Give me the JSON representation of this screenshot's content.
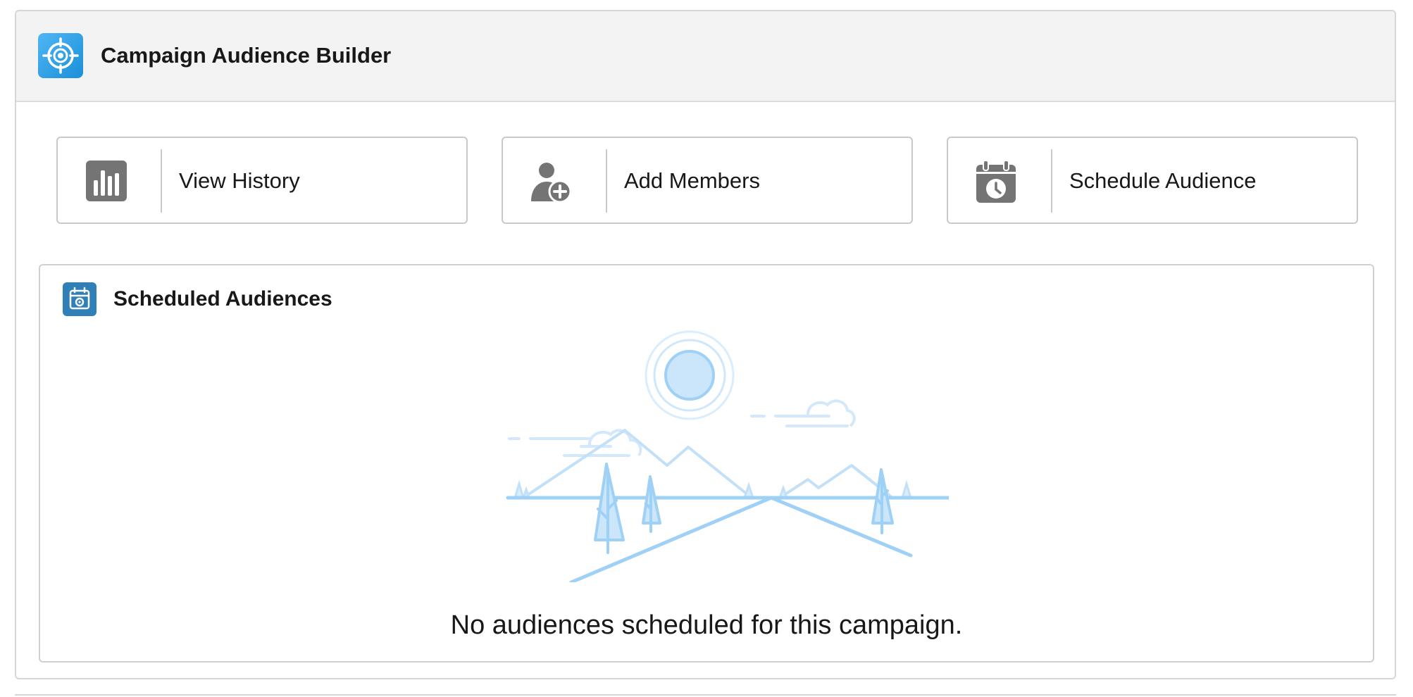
{
  "app": {
    "title": "Campaign Audience Builder",
    "icon": "target-icon",
    "accent_color": "#1b8fd8"
  },
  "actions": [
    {
      "label": "View History",
      "icon": "bar-chart-icon"
    },
    {
      "label": "Add Members",
      "icon": "add-user-icon"
    },
    {
      "label": "Schedule Audience",
      "icon": "calendar-clock-icon"
    }
  ],
  "scheduled": {
    "title": "Scheduled Audiences",
    "icon": "calendar-icon",
    "empty_message": "No audiences scheduled for this campaign.",
    "illustration": "empty-state-mountains-illustration"
  },
  "colors": {
    "header_bg": "#f3f3f3",
    "border": "#d6d6d6",
    "icon_gray": "#747474",
    "illustration_blue": "#9fd0f5"
  }
}
